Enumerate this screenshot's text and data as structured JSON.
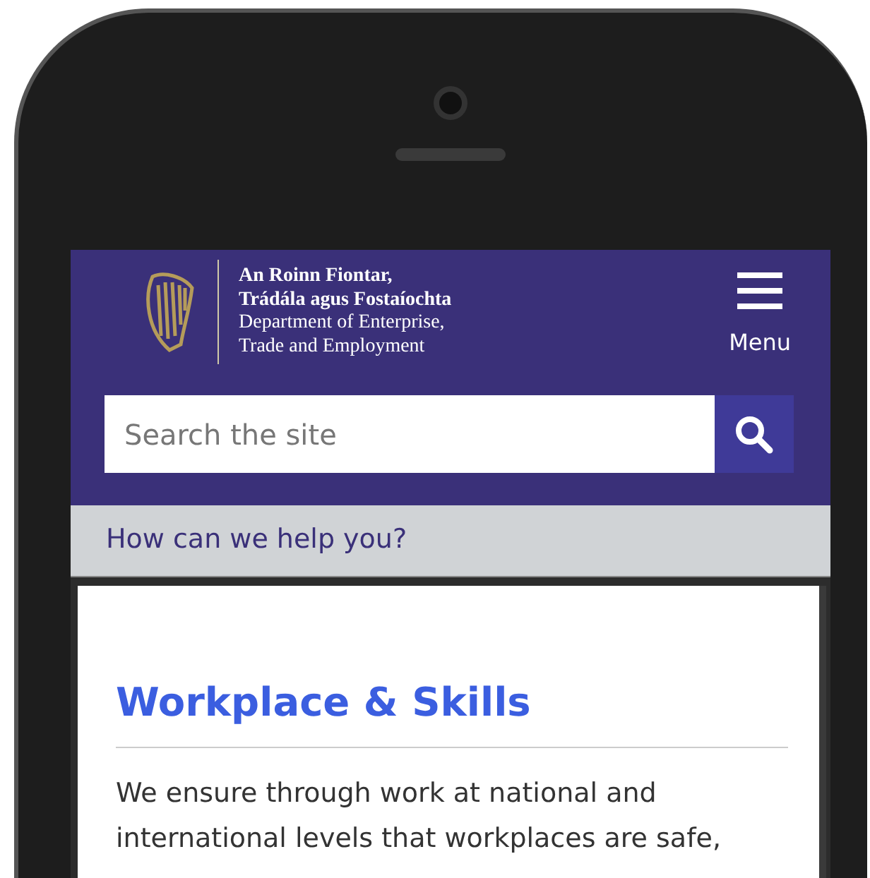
{
  "header": {
    "logo_lines": [
      {
        "text": "An Roinn Fiontar,",
        "bold": true
      },
      {
        "text": "Trádála agus Fostaíochta",
        "bold": true
      },
      {
        "text": "Department of Enterprise,",
        "bold": false
      },
      {
        "text": "Trade and Employment",
        "bold": false
      }
    ],
    "menu_label": "Menu"
  },
  "search": {
    "placeholder": "Search the site"
  },
  "help_bar": "How can we help you?",
  "content": {
    "heading": "Workplace & Skills",
    "paragraph": "We ensure through work at national and international levels that workplaces are safe,"
  }
}
